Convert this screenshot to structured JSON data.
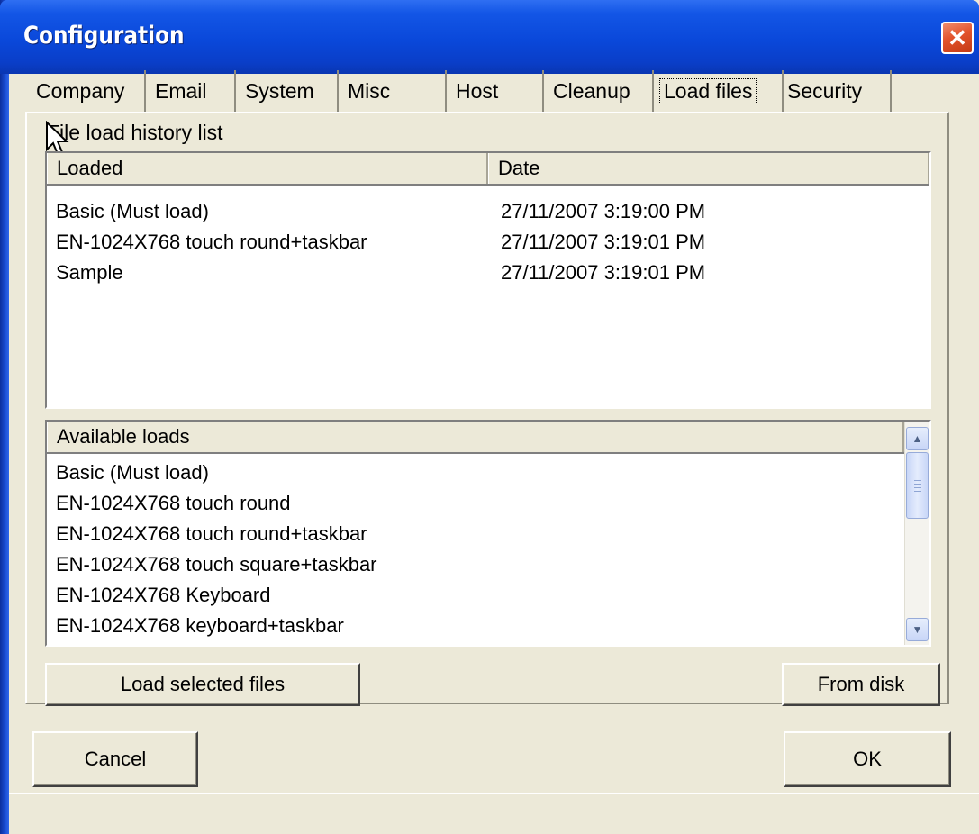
{
  "window": {
    "title": "Configuration",
    "close_icon": "close-icon"
  },
  "tabs": [
    {
      "label": "Company",
      "active": false
    },
    {
      "label": "Email",
      "active": false
    },
    {
      "label": "System",
      "active": false
    },
    {
      "label": "Misc",
      "active": false
    },
    {
      "label": "Host",
      "active": false
    },
    {
      "label": "Cleanup",
      "active": false
    },
    {
      "label": "Load files",
      "active": true
    },
    {
      "label": "Security",
      "active": false
    }
  ],
  "group_label": "File load history list",
  "history": {
    "columns": [
      "Loaded",
      "Date"
    ],
    "rows": [
      {
        "loaded": "Basic (Must load)",
        "date": "27/11/2007 3:19:00 PM"
      },
      {
        "loaded": "EN-1024X768 touch round+taskbar",
        "date": "27/11/2007 3:19:01 PM"
      },
      {
        "loaded": "Sample",
        "date": "27/11/2007 3:19:01 PM"
      }
    ]
  },
  "available": {
    "column": "Available loads",
    "items": [
      "Basic (Must load)",
      "EN-1024X768 touch round",
      "EN-1024X768 touch round+taskbar",
      "EN-1024X768 touch square+taskbar",
      "EN-1024X768 Keyboard",
      "EN-1024X768 keyboard+taskbar"
    ]
  },
  "buttons": {
    "load_selected": "Load selected files",
    "from_disk": "From disk",
    "cancel": "Cancel",
    "ok": "OK"
  },
  "colors": {
    "title_blue": "#0a48da",
    "dialog_face": "#ece9d8",
    "close_red": "#e2532c"
  }
}
